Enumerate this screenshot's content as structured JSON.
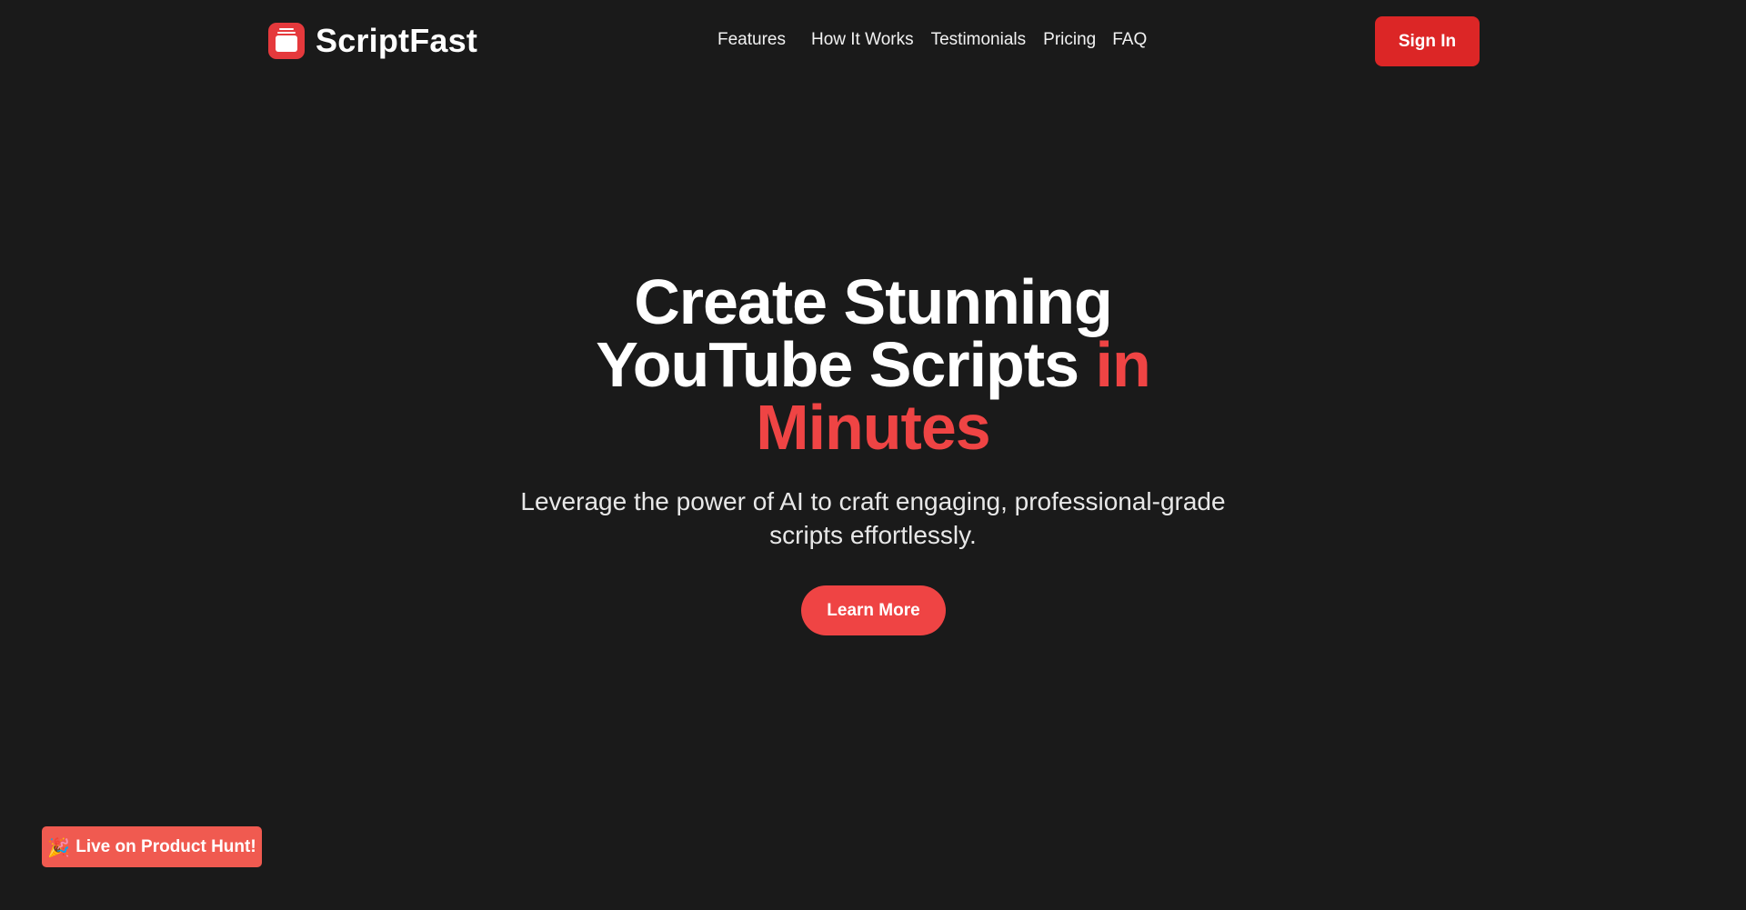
{
  "header": {
    "brand_name": "ScriptFast",
    "nav": [
      {
        "label": "Features"
      },
      {
        "label": "How It Works"
      },
      {
        "label": "Testimonials"
      },
      {
        "label": "Pricing"
      },
      {
        "label": "FAQ"
      }
    ],
    "sign_in_label": "Sign In"
  },
  "hero": {
    "title_part1": "Create Stunning YouTube Scripts ",
    "title_accent": "in Minutes",
    "subtitle": "Leverage the power of AI to craft engaging, professional-grade scripts effortlessly.",
    "cta_label": "Learn More"
  },
  "badge": {
    "icon": "🎉",
    "label": "Live on Product Hunt!"
  },
  "colors": {
    "background": "#1a1a1a",
    "accent": "#ef4444",
    "sign_in": "#dc2626",
    "badge": "#f05a50"
  },
  "icons": {
    "logo": "clapperboard-logo-icon",
    "badge": "party-popper-icon"
  }
}
